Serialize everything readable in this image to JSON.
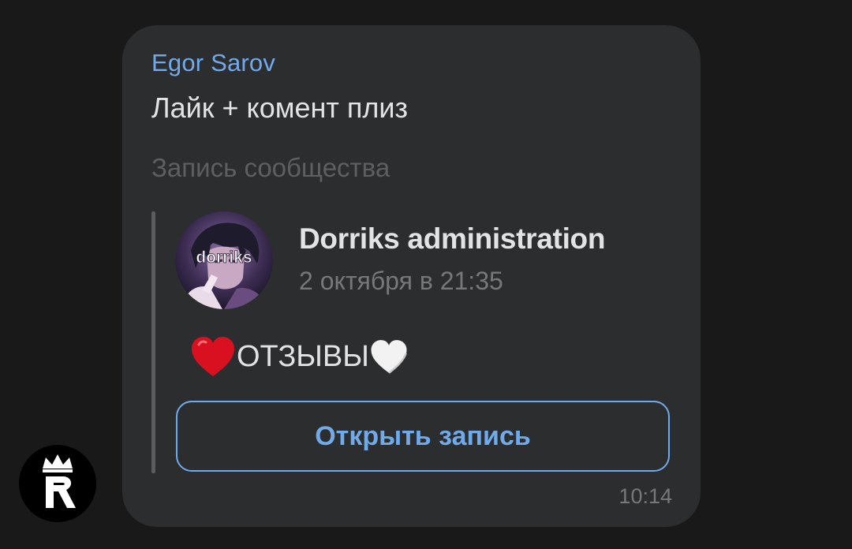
{
  "message": {
    "author": "Egor Sarov",
    "text": "Лайк + комент плиз",
    "time": "10:14"
  },
  "repost": {
    "label": "Запись сообщества",
    "group_name": "Dorriks administration",
    "date": "2 октября в 21:35",
    "avatar_label": "dorriks",
    "post_text": "ОТЗЫВЫ",
    "post_text_icons": [
      "red-heart-icon",
      "white-heart-icon"
    ],
    "open_button_label": "Открыть запись"
  },
  "sender_avatar": {
    "logo_letter": "R",
    "icon": "crown-icon"
  },
  "colors": {
    "background": "#191919",
    "bubble": "#2c2d2e",
    "accent": "#71aaeb",
    "text_primary": "#e1e3e6",
    "text_secondary": "#76787a",
    "red_heart": "#d9101f",
    "white_heart": "#f2f2f2"
  }
}
